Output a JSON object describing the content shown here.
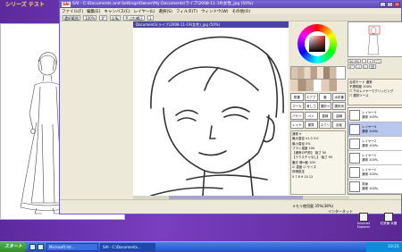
{
  "desktop": {
    "logo_text": "シリーズ\nテスト"
  },
  "sai": {
    "title": "SAI - C:\\Documents and Settings\\Owner\\My Documents\\ライブ\\2008-11-19\\女性_jpg (50%)",
    "title_short": "SAI",
    "menu": [
      "ファイル(F)",
      "編集(E)",
      "キャンバス(C)",
      "レイヤー(L)",
      "選択(S)",
      "フィルタ(T)",
      "ウィンドウ(W)",
      "その他(O)"
    ],
    "toolbar": [
      "選択範囲",
      "100%",
      "0°",
      "反転",
      "手ぶれ補正",
      "3"
    ],
    "canvas_tab": "Document1(ライブ)2008-11-19(女性)_jpg (50%)",
    "tools": [
      "鉛筆",
      "エアブラシ",
      "筆",
      "水彩筆",
      "マーカー",
      "消しゴム",
      "選択ペン",
      "選択消し",
      "バケツ",
      "ペン",
      "直線",
      "曲線",
      "レイヤー",
      "乗算",
      "スクリーン",
      "反転"
    ],
    "brush_options": [
      "通常 ▾",
      "最大直径 x1.0  3.0",
      "最小直径 0%",
      "ブラシ濃度 100",
      "【通常の円形】 強さ 50",
      "【テクスチャなし】 強さ 95",
      "筆圧 硬⇔軟 100",
      "☑ 濃度 ☑ サイズ",
      "詳細設定",
      "5 7 8 9 10 12"
    ],
    "nav_zoom": [
      [
        "50.0%",
        "-",
        "+",
        "□"
      ],
      [
        "0°",
        "◁",
        "▷",
        "回"
      ]
    ],
    "layer_options": [
      "合成モード 通常",
      "不透明度 100%",
      "☐ 下のレイヤーでクリッピング",
      "☐ 選択ソース"
    ],
    "layers": [
      {
        "name": "レイヤー3",
        "mode": "通常 100%"
      },
      {
        "name": "レイヤー4",
        "mode": "通常 100%"
      },
      {
        "name": "レイヤー2",
        "mode": "通常 100%"
      },
      {
        "name": "レイヤー1",
        "mode": "通常 100%"
      },
      {
        "name": "レイヤー1",
        "mode": "通常 100%"
      },
      {
        "name": "背景",
        "mode": "通常 100%"
      }
    ],
    "status_left": "メモリ使用量 35%(38%)",
    "status_mid": "インターネット"
  },
  "desk_icons": [
    {
      "label": "Internet\nExplorer"
    },
    {
      "label": "紅茶鯖\n本棚"
    }
  ],
  "taskbar": {
    "start_label": "スタート",
    "buttons": [
      {
        "label": "Microsoft Int..."
      },
      {
        "label": "SAI - C:\\Documents..."
      }
    ],
    "clock": "10:21"
  }
}
